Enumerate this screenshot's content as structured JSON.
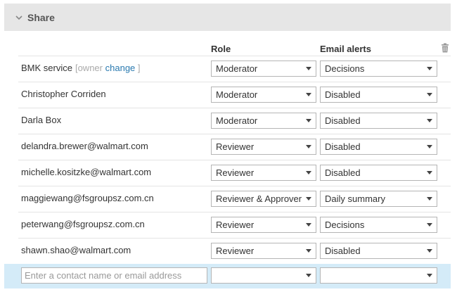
{
  "panel": {
    "title": "Share"
  },
  "columns": {
    "role": "Role",
    "email_alerts": "Email alerts"
  },
  "rows": [
    {
      "name": "BMK service",
      "owner_prefix": "[owner",
      "owner_link": "change",
      "owner_suffix": "]",
      "role": "Moderator",
      "alert": "Decisions"
    },
    {
      "name": "Christopher Corriden",
      "role": "Moderator",
      "alert": "Disabled"
    },
    {
      "name": "Darla Box",
      "role": "Moderator",
      "alert": "Disabled"
    },
    {
      "name": "delandra.brewer@walmart.com",
      "role": "Reviewer",
      "alert": "Disabled"
    },
    {
      "name": "michelle.kositzke@walmart.com",
      "role": "Reviewer",
      "alert": "Disabled"
    },
    {
      "name": "maggiewang@fsgroupsz.com.cn",
      "role": "Reviewer & Approver",
      "alert": "Daily summary"
    },
    {
      "name": "peterwang@fsgroupsz.com.cn",
      "role": "Reviewer",
      "alert": "Decisions"
    },
    {
      "name": "shawn.shao@walmart.com",
      "role": "Reviewer",
      "alert": "Disabled"
    }
  ],
  "add_contact": {
    "placeholder": "Enter a contact name or email address",
    "role": "",
    "alert": ""
  },
  "icons": {
    "collapse": "chevron-down-icon",
    "delete": "trash-icon",
    "dropdown": "caret-down-icon"
  },
  "colors": {
    "header_bg": "#e6e6e6",
    "add_row_bg": "#d4ebf8",
    "link": "#2a7ab0"
  }
}
